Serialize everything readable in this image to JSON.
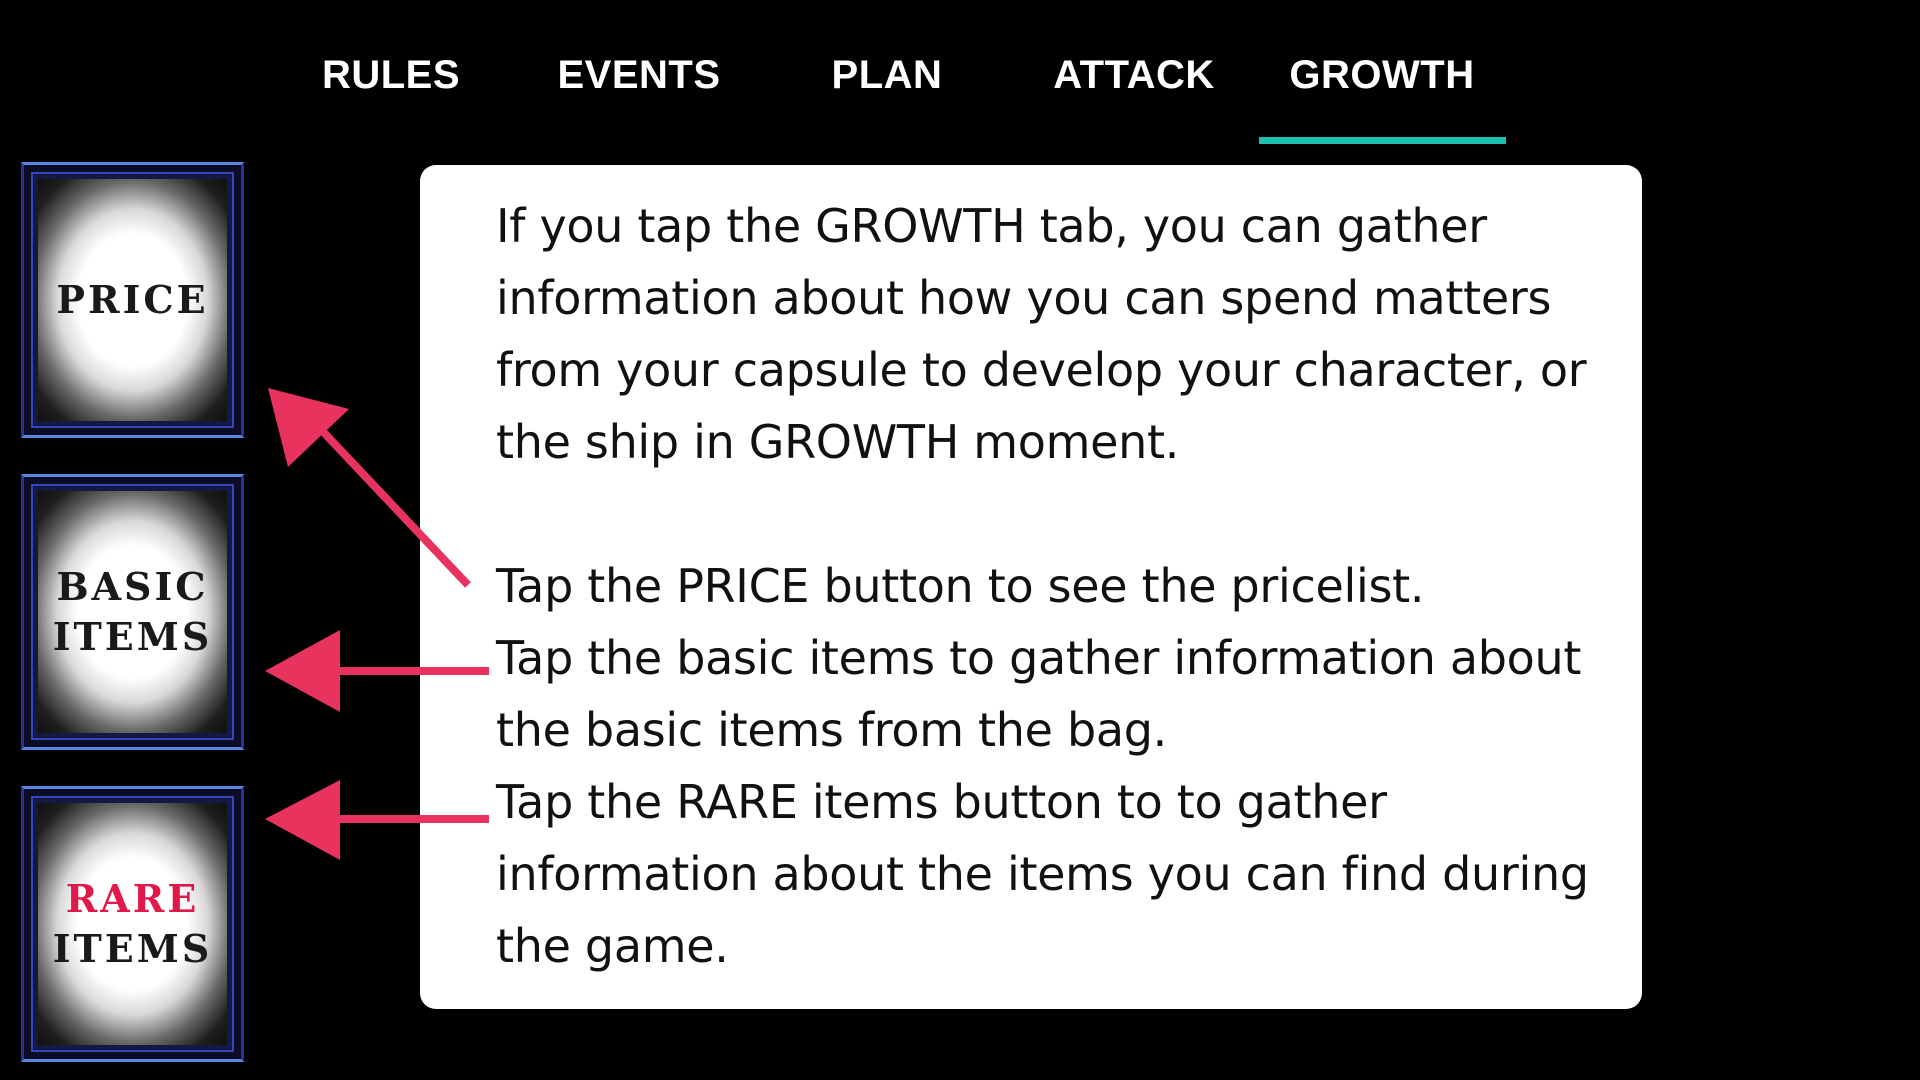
{
  "tabs": [
    {
      "label": "RULES"
    },
    {
      "label": "EVENTS"
    },
    {
      "label": "PLAN"
    },
    {
      "label": "ATTACK"
    },
    {
      "label": "GROWTH"
    }
  ],
  "active_tab": "GROWTH",
  "menu": {
    "price": {
      "line1": "PRICE"
    },
    "basic": {
      "line1": "BASIC",
      "line2": "ITEMS"
    },
    "rare": {
      "line1": "RARE",
      "line2": "ITEMS"
    }
  },
  "card": {
    "intro": "If you tap the GROWTH tab, you can gather information about how you can spend matters from your capsule to develop your character, or the ship in GROWTH moment.",
    "price_text": "Tap the PRICE button to see the pricelist.",
    "basic_text": "Tap the basic items to gather information about the basic items from the bag.",
    "rare_text": "Tap the RARE items button to to gather information about the items you can find during the game."
  },
  "colors": {
    "background": "#000000",
    "tab_indicator": "#1fbfb0",
    "arrow": "#e8335f",
    "rare_label": "#e0194a",
    "button_frame": "#2a2f9a"
  },
  "icons": {
    "arrow_to_price": "arrow-diagonal-icon",
    "arrow_to_basic": "arrow-left-icon",
    "arrow_to_rare": "arrow-left-icon"
  }
}
